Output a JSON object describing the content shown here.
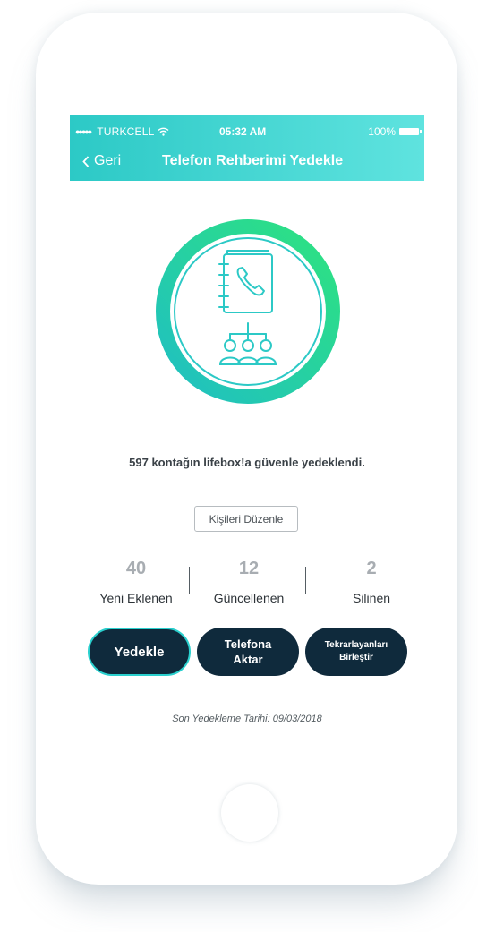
{
  "status_bar": {
    "carrier": "TURKCELL",
    "time": "05:32 AM",
    "battery": "100%"
  },
  "nav": {
    "back_label": "Geri",
    "title": "Telefon Rehberimi Yedekle"
  },
  "summary": {
    "count": "597",
    "text": " kontağın lifebox!a güvenle yedeklendi."
  },
  "edit_contacts_label": "Kişileri Düzenle",
  "stats": [
    {
      "value": "40",
      "label": "Yeni Eklenen"
    },
    {
      "value": "12",
      "label": "Güncellenen"
    },
    {
      "value": "2",
      "label": "Silinen"
    }
  ],
  "actions": {
    "backup": "Yedekle",
    "transfer_line1": "Telefona",
    "transfer_line2": "Aktar",
    "merge_line1": "Tekrarlayanları",
    "merge_line2": "Birleştir"
  },
  "last_backup": "Son Yedekleme Tarihi: 09/03/2018",
  "colors": {
    "accent_teal": "#2cc9c6",
    "accent_green": "#26d98a",
    "button_dark": "#0f2a3c"
  },
  "icons": [
    "wifi-icon",
    "battery-icon",
    "chevron-left-icon",
    "contact-book-icon",
    "phone-icon",
    "people-network-icon"
  ]
}
